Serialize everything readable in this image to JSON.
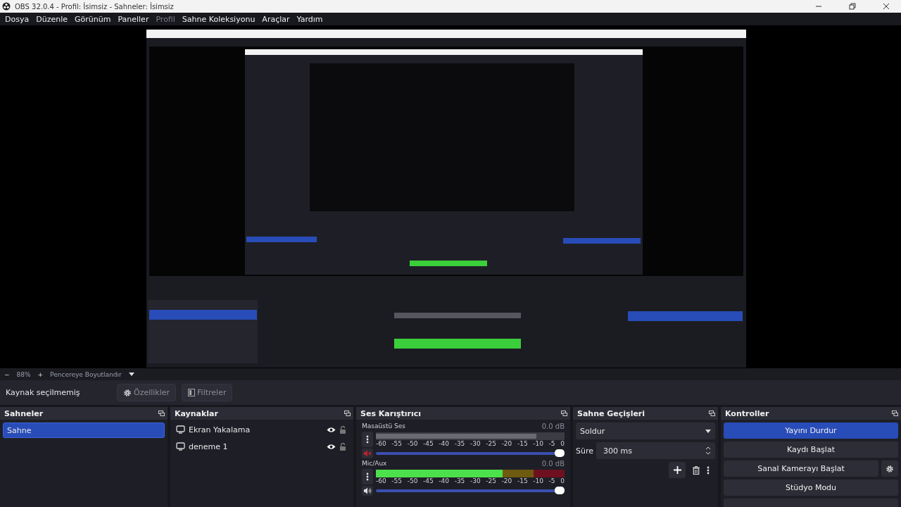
{
  "window": {
    "title": "OBS 32.0.4 - Profil: İsimsiz - Sahneler: İsimsiz"
  },
  "menu": [
    {
      "label": "Dosya",
      "disabled": false
    },
    {
      "label": "Düzenle",
      "disabled": false
    },
    {
      "label": "Görünüm",
      "disabled": false
    },
    {
      "label": "Paneller",
      "disabled": false
    },
    {
      "label": "Profil",
      "disabled": true
    },
    {
      "label": "Sahne Koleksiyonu",
      "disabled": false
    },
    {
      "label": "Araçlar",
      "disabled": false
    },
    {
      "label": "Yardım",
      "disabled": false
    }
  ],
  "zoom_bar": {
    "minus": "−",
    "zoom": "88%",
    "plus": "+",
    "fit": "Pencereye Boyutlandır"
  },
  "source_toolbar": {
    "status": "Kaynak seçilmemiş",
    "properties": "Özellikler",
    "filters": "Filtreler"
  },
  "scenes": {
    "title": "Sahneler",
    "items": [
      {
        "label": "Sahne",
        "selected": true
      }
    ]
  },
  "sources": {
    "title": "Kaynaklar",
    "items": [
      {
        "label": "Ekran Yakalama",
        "visible": true,
        "locked": false
      },
      {
        "label": "deneme 1",
        "visible": true,
        "locked": false
      }
    ]
  },
  "mixer": {
    "title": "Ses Karıştırıcı",
    "channels": [
      {
        "name": "Masaüstü Ses",
        "reading": "0.0 dB",
        "muted": true,
        "level": 0.85,
        "volume": {
          "level": 1
        },
        "ticks": [
          "-60",
          "-55",
          "-50",
          "-45",
          "-40",
          "-35",
          "-30",
          "-25",
          "-20",
          "-15",
          "-10",
          "-5",
          "0"
        ]
      },
      {
        "name": "Mic/Aux",
        "reading": "0.0 dB",
        "muted": false,
        "level": 0.67,
        "volume": {
          "level": 1
        },
        "ticks": [
          "-60",
          "-55",
          "-50",
          "-45",
          "-40",
          "-35",
          "-30",
          "-25",
          "-20",
          "-15",
          "-10",
          "-5",
          "0"
        ]
      }
    ]
  },
  "transitions": {
    "title": "Sahne Geçişleri",
    "select": "Soldur",
    "duration_label": "Süre",
    "duration": "300 ms"
  },
  "controls": {
    "title": "Kontroller",
    "buttons": [
      {
        "label": "Yayını Durdur",
        "kind": "plain",
        "active": true
      },
      {
        "label": "Kaydı Başlat",
        "kind": "plain",
        "active": false
      },
      {
        "label": "Sanal Kamerayı Başlat",
        "kind": "with-settings",
        "active": false
      },
      {
        "label": "Stüdyo Modu",
        "kind": "plain",
        "active": false
      },
      {
        "kind": "cut-off",
        "active": false
      }
    ]
  }
}
